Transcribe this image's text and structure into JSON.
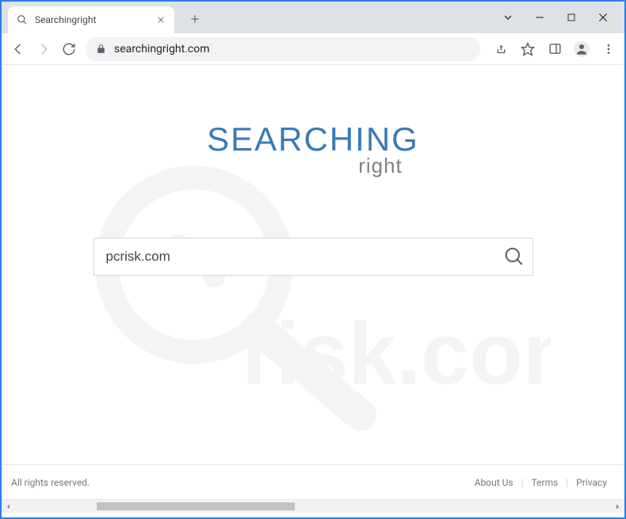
{
  "browser": {
    "tab_title": "Searchingright",
    "url": "searchingright.com"
  },
  "page": {
    "logo_main": "SEARCHING",
    "logo_sub": "right",
    "search_value": "pcrisk.com"
  },
  "footer": {
    "left": "All rights reserved.",
    "links": {
      "about": "About Us",
      "terms": "Terms",
      "privacy": "Privacy"
    }
  }
}
